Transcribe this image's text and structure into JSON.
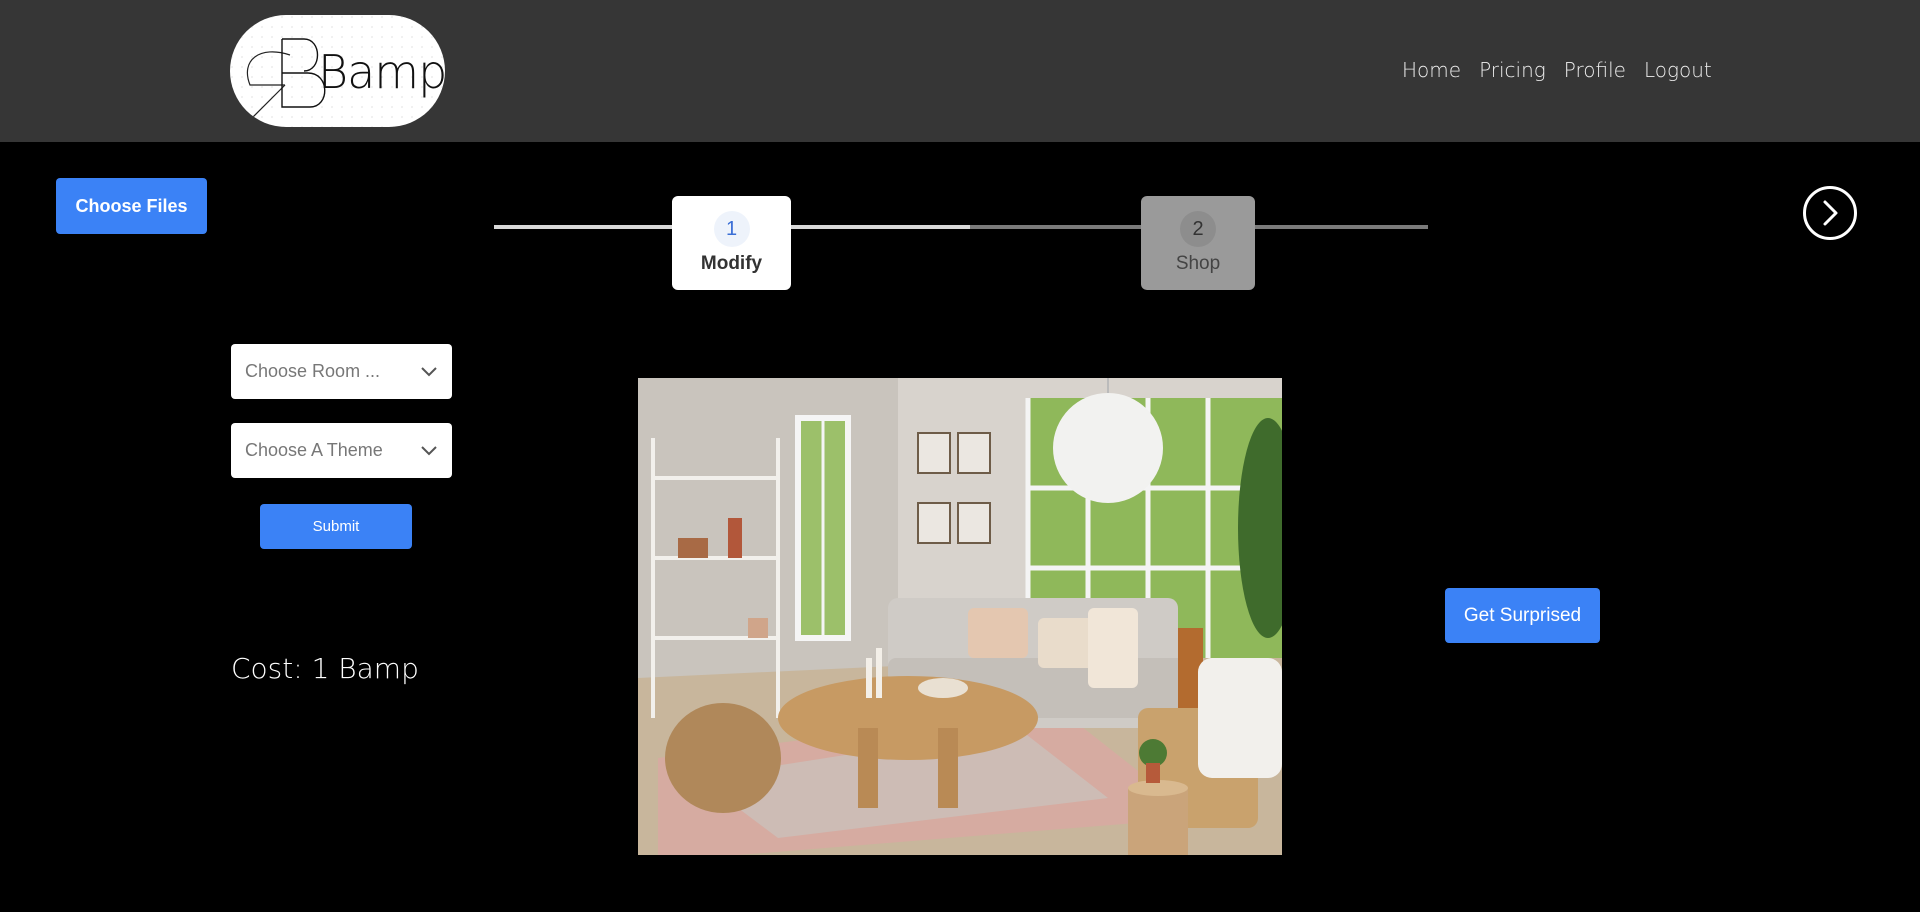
{
  "header": {
    "logo_text": "Bamp",
    "nav": [
      "Home",
      "Pricing",
      "Profile",
      "Logout"
    ]
  },
  "upload": {
    "label": "Choose Files"
  },
  "steps": [
    {
      "number": "1",
      "label": "Modify",
      "active": true
    },
    {
      "number": "2",
      "label": "Shop",
      "active": false
    }
  ],
  "form": {
    "room_placeholder": "Choose Room ...",
    "theme_placeholder": "Choose A Theme",
    "submit_label": "Submit"
  },
  "cost_text": "Cost: 1 Bamp",
  "surprise_label": "Get Surprised",
  "colors": {
    "accent": "#3b82f6",
    "header_bg": "#363636",
    "page_bg": "#000000"
  }
}
